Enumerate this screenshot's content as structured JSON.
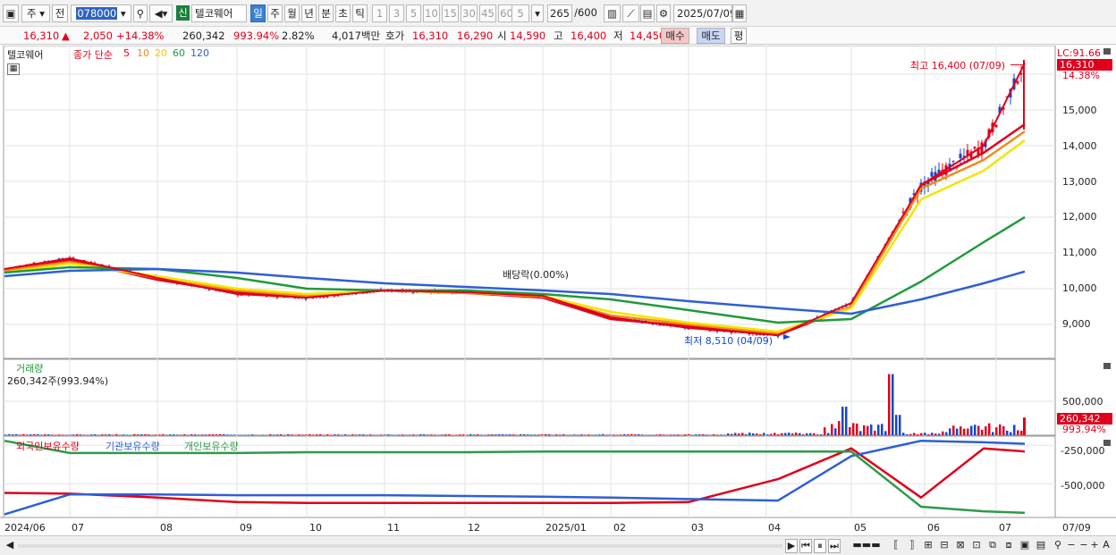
{
  "toolbar": {
    "period_label": "주",
    "prev_label": "전",
    "stock_code": "078000",
    "badge_new": "신",
    "stock_name": "텔코웨어",
    "tf_day": "일",
    "tf_week": "주",
    "tf_month": "월",
    "tf_year": "년",
    "tf_minute": "분",
    "tf_second": "초",
    "tf_tick": "틱",
    "intervals": [
      "1",
      "3",
      "5",
      "10",
      "15",
      "30",
      "45",
      "60"
    ],
    "n_value": "5",
    "count_value": "265",
    "count_total": "/600",
    "date_value": "2025/07/09"
  },
  "quote": {
    "price": "16,310",
    "arrow": "▲",
    "change": "2,050",
    "change_pct": "+14.38%",
    "volume": "260,342",
    "vol_ratio": "993.94%",
    "turnover": "2.82%",
    "amount": "4,017백만",
    "hoga_label": "호가",
    "ask": "16,310",
    "bid": "16,290",
    "open_label": "시",
    "open": "14,590",
    "high_label": "고",
    "high": "16,400",
    "low_label": "저",
    "low": "14,450",
    "buy_label": "매수",
    "sell_label": "매도",
    "eval_label": "평"
  },
  "price_panel": {
    "name": "텔코웨어",
    "ma_label": "종가 단순",
    "ma_periods": [
      "5",
      "10",
      "20",
      "60",
      "120"
    ],
    "lc_label": "LC:91.66",
    "cur_price": "16,310",
    "cur_pct": "14.38%",
    "high_note": "최고 16,400 (07/09)",
    "low_note": "최저 8,510 (04/09)",
    "dividend_note": "배당락(0.00%)",
    "y_ticks": [
      "15,000",
      "14,000",
      "13,000",
      "12,000",
      "11,000",
      "10,000",
      "9,000"
    ]
  },
  "volume_panel": {
    "title": "거래량",
    "summary": "260,342주(993.94%)",
    "y_tick": "500,000",
    "cur_value": "260,342",
    "cur_pct": "993.94%"
  },
  "holding_panel": {
    "legend": [
      "외국인보유수량",
      "기관보유수량",
      "개인보유수량"
    ],
    "y_ticks": [
      "-250,000",
      "-500,000"
    ]
  },
  "x_axis": {
    "labels": [
      "2024/06",
      "07",
      "08",
      "09",
      "10",
      "11",
      "12",
      "2025/01",
      "02",
      "03",
      "04",
      "05",
      "06",
      "07"
    ],
    "right_label": "07/09"
  },
  "colors": {
    "up": "#e0001b",
    "down": "#1646c8",
    "ma5": "#e0001b",
    "ma10": "#f08a1c",
    "ma20": "#f2e600",
    "ma60": "#1f9a3a",
    "ma120": "#2f5fd6",
    "foreign": "#e0001b",
    "institution": "#2f5fd6",
    "individual": "#2e9a4a"
  },
  "chart_data": [
    {
      "type": "line",
      "title": "텔코웨어",
      "x": [
        "2024/06",
        "07",
        "08",
        "09",
        "10",
        "11",
        "12",
        "2025/01",
        "02",
        "03",
        "04",
        "05",
        "06",
        "07"
      ],
      "ylim": [
        8200,
        16600
      ],
      "series": [
        {
          "name": "종가",
          "values": [
            10550,
            10850,
            10300,
            9850,
            9750,
            9950,
            9900,
            9800,
            9200,
            8900,
            8700,
            9600,
            12900,
            14000,
            16310
          ]
        },
        {
          "name": "5",
          "values": [
            10500,
            10800,
            10250,
            9900,
            9800,
            9950,
            9880,
            9750,
            9150,
            8950,
            8700,
            9500,
            12900,
            13800,
            14600
          ]
        },
        {
          "name": "10",
          "values": [
            10500,
            10750,
            10300,
            9950,
            9800,
            9950,
            9880,
            9780,
            9250,
            9000,
            8750,
            9500,
            12800,
            13600,
            14400
          ]
        },
        {
          "name": "20",
          "values": [
            10450,
            10700,
            10350,
            10000,
            9850,
            9950,
            9900,
            9800,
            9350,
            9050,
            8800,
            9450,
            12500,
            13300,
            14150
          ]
        },
        {
          "name": "60",
          "values": [
            10450,
            10600,
            10550,
            10300,
            10000,
            9950,
            9950,
            9850,
            9700,
            9400,
            9050,
            9150,
            10200,
            11300,
            12000
          ]
        },
        {
          "name": "120",
          "values": [
            10350,
            10500,
            10550,
            10450,
            10300,
            10150,
            10050,
            9950,
            9850,
            9650,
            9450,
            9300,
            9700,
            10150,
            10480
          ]
        }
      ]
    },
    {
      "type": "bar",
      "title": "거래량",
      "categories": [
        "2024/06",
        "07",
        "08",
        "09",
        "10",
        "11",
        "12",
        "2025/01",
        "02",
        "03",
        "04",
        "05",
        "06",
        "07"
      ],
      "values": [
        20000,
        20000,
        15000,
        15000,
        12000,
        10000,
        10000,
        10000,
        12000,
        15000,
        40000,
        900000,
        120000,
        160000,
        260342
      ],
      "ylim": [
        0,
        1000000
      ]
    },
    {
      "type": "line",
      "title": "외국인보유수량 / 기관보유수량 / 개인보유수량",
      "x": [
        "2024/06",
        "07",
        "08",
        "09",
        "10",
        "11",
        "12",
        "2025/01",
        "02",
        "03",
        "04",
        "05",
        "06",
        "07"
      ],
      "ylim": [
        -720000,
        -190000
      ],
      "series": [
        {
          "name": "외국인보유수량",
          "values": [
            -560000,
            -565000,
            -590000,
            -620000,
            -625000,
            -625000,
            -625000,
            -625000,
            -625000,
            -620000,
            -470000,
            -270000,
            -590000,
            -270000,
            -290000
          ]
        },
        {
          "name": "기관보유수량",
          "values": [
            -700000,
            -570000,
            -570000,
            -575000,
            -575000,
            -575000,
            -580000,
            -585000,
            -590000,
            -600000,
            -610000,
            -320000,
            -220000,
            -230000,
            -240000
          ]
        },
        {
          "name": "개인보유수량",
          "values": [
            -220000,
            -300000,
            -300000,
            -300000,
            -295000,
            -295000,
            -295000,
            -290000,
            -290000,
            -290000,
            -290000,
            -290000,
            -650000,
            -680000,
            -690000
          ]
        }
      ]
    }
  ]
}
